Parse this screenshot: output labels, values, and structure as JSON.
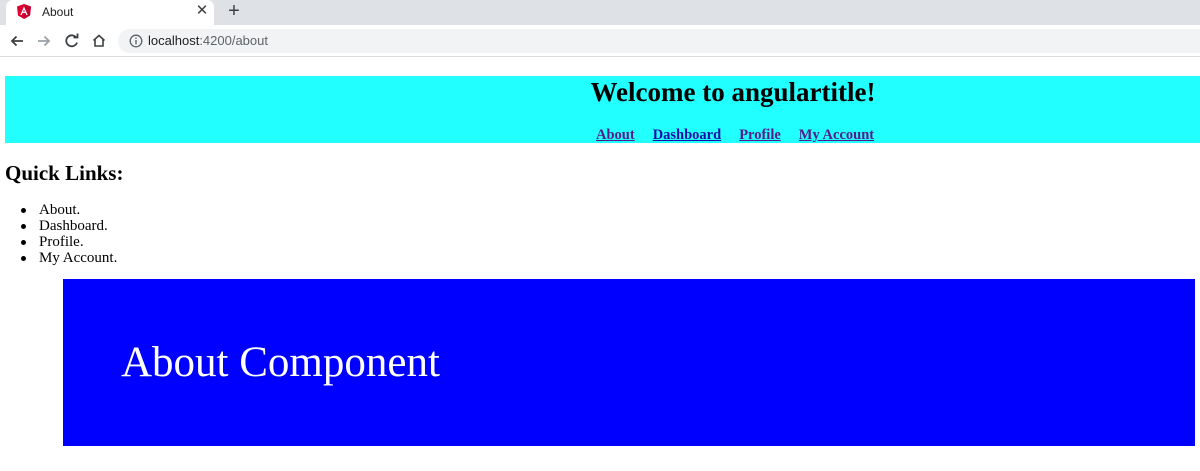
{
  "browser": {
    "tab": {
      "title": "About",
      "favicon": "angular-icon",
      "close_glyph": "✕"
    },
    "new_tab_glyph": "+",
    "toolbar": {
      "back": "back-arrow-icon",
      "forward": "forward-arrow-icon",
      "reload": "reload-icon",
      "home": "home-icon"
    },
    "address": {
      "host": "localhost",
      "path": ":4200/about",
      "info_icon": "info-icon"
    }
  },
  "header": {
    "title": "Welcome to angulartitle!",
    "background": "#22ffff",
    "nav": [
      "About",
      "Dashboard",
      "Profile",
      "My Account"
    ]
  },
  "quick_links": {
    "title": "Quick Links:",
    "items": [
      "About.",
      "Dashboard.",
      "Profile.",
      "My Account."
    ]
  },
  "about_component": {
    "text": "About Component",
    "background": "#0000ff",
    "text_color": "#ffffff"
  }
}
